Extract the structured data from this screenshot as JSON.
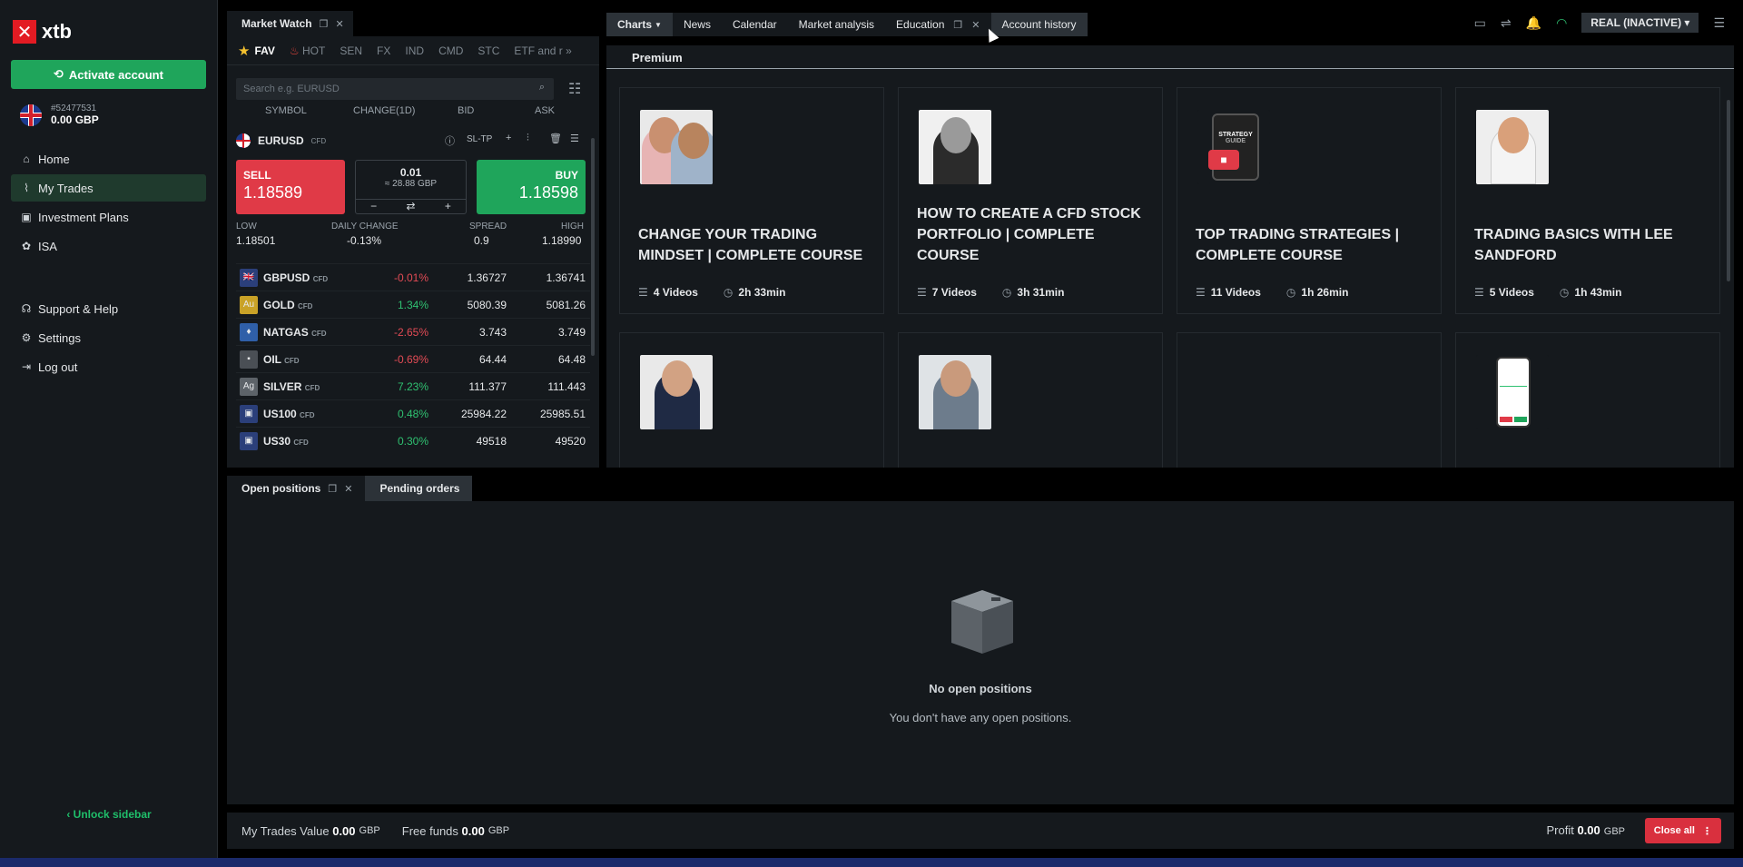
{
  "sidebar": {
    "logo_mark": "✕",
    "logo_text": "xtb",
    "activate_label": "Activate account",
    "account_id": "#52477531",
    "balance": "0.00 GBP",
    "nav": [
      {
        "label": "Home",
        "icon": "home-icon"
      },
      {
        "label": "My Trades",
        "icon": "trades-icon"
      },
      {
        "label": "Investment Plans",
        "icon": "plans-icon"
      },
      {
        "label": "ISA",
        "icon": "piggy-icon"
      },
      {
        "label": "Support & Help",
        "icon": "support-icon"
      },
      {
        "label": "Settings",
        "icon": "gear-icon"
      },
      {
        "label": "Log out",
        "icon": "logout-icon"
      }
    ],
    "unlock_label": "Unlock sidebar"
  },
  "market_watch": {
    "title": "Market Watch",
    "tabs": [
      "FAV",
      "HOT",
      "SEN",
      "FX",
      "IND",
      "CMD",
      "STC",
      "ETF and r"
    ],
    "search_placeholder": "Search e.g. EURUSD",
    "columns": {
      "symbol": "SYMBOL",
      "change": "CHANGE(1D)",
      "bid": "BID",
      "ask": "ASK"
    },
    "selected": {
      "symbol": "EURUSD",
      "type": "CFD",
      "sltp": "SL-TP",
      "sell_label": "SELL",
      "sell_price": "1.18589",
      "buy_label": "BUY",
      "buy_price": "1.18598",
      "volume": "0.01",
      "volume_gbp": "≈ 28.88 GBP",
      "low_label": "LOW",
      "low": "1.18501",
      "daily_label": "DAILY CHANGE",
      "daily": "-0.13%",
      "spread_label": "SPREAD",
      "spread": "0.9",
      "high_label": "HIGH",
      "high": "1.18990"
    },
    "rows": [
      {
        "symbol": "GBPUSD",
        "type": "CFD",
        "change": "-0.01%",
        "bid": "1.36727",
        "ask": "1.36741",
        "dir": "neg",
        "icon": "🇬🇧",
        "icon_bg": "#2b3f7a"
      },
      {
        "symbol": "GOLD",
        "type": "CFD",
        "change": "1.34%",
        "bid": "5080.39",
        "ask": "5081.26",
        "dir": "pos",
        "icon": "Au",
        "icon_bg": "#c9a227"
      },
      {
        "symbol": "NATGAS",
        "type": "CFD",
        "change": "-2.65%",
        "bid": "3.743",
        "ask": "3.749",
        "dir": "neg",
        "icon": "♦",
        "icon_bg": "#2f5fa8"
      },
      {
        "symbol": "OIL",
        "type": "CFD",
        "change": "-0.69%",
        "bid": "64.44",
        "ask": "64.48",
        "dir": "neg",
        "icon": "▪",
        "icon_bg": "#4a4f55"
      },
      {
        "symbol": "SILVER",
        "type": "CFD",
        "change": "7.23%",
        "bid": "111.377",
        "ask": "111.443",
        "dir": "pos",
        "icon": "Ag",
        "icon_bg": "#5d6369"
      },
      {
        "symbol": "US100",
        "type": "CFD",
        "change": "0.48%",
        "bid": "25984.22",
        "ask": "25985.51",
        "dir": "pos",
        "icon": "▣",
        "icon_bg": "#2b3f7a"
      },
      {
        "symbol": "US30",
        "type": "CFD",
        "change": "0.30%",
        "bid": "49518",
        "ask": "49520",
        "dir": "pos",
        "icon": "▣",
        "icon_bg": "#2b3f7a"
      }
    ]
  },
  "top_tabs": [
    "Charts",
    "News",
    "Calendar",
    "Market analysis",
    "Education",
    "Account history"
  ],
  "account_mode": "REAL (INACTIVE)",
  "education": {
    "section": "Premium",
    "courses": [
      {
        "title": "CHANGE YOUR TRADING MINDSET | COMPLETE COURSE",
        "videos": "4 Videos",
        "duration": "2h 33min"
      },
      {
        "title": "HOW TO CREATE A CFD STOCK PORTFOLIO | COMPLETE COURSE",
        "videos": "7 Videos",
        "duration": "3h 31min"
      },
      {
        "title": "TOP TRADING STRATEGIES | COMPLETE COURSE",
        "videos": "11 Videos",
        "duration": "1h 26min"
      },
      {
        "title": "TRADING BASICS WITH LEE SANDFORD",
        "videos": "5 Videos",
        "duration": "1h 43min"
      }
    ],
    "strategy_thumb_lines": [
      "STRATEGY",
      "GUIDE"
    ]
  },
  "positions": {
    "tab_open": "Open positions",
    "tab_pending": "Pending orders",
    "empty_title": "No open positions",
    "empty_text": "You don't have any open positions."
  },
  "footer": {
    "trades_label": "My Trades Value",
    "trades_value": "0.00",
    "free_label": "Free funds",
    "free_value": "0.00",
    "currency": "GBP",
    "profit_label": "Profit",
    "profit_value": "0.00",
    "close_all": "Close all"
  }
}
